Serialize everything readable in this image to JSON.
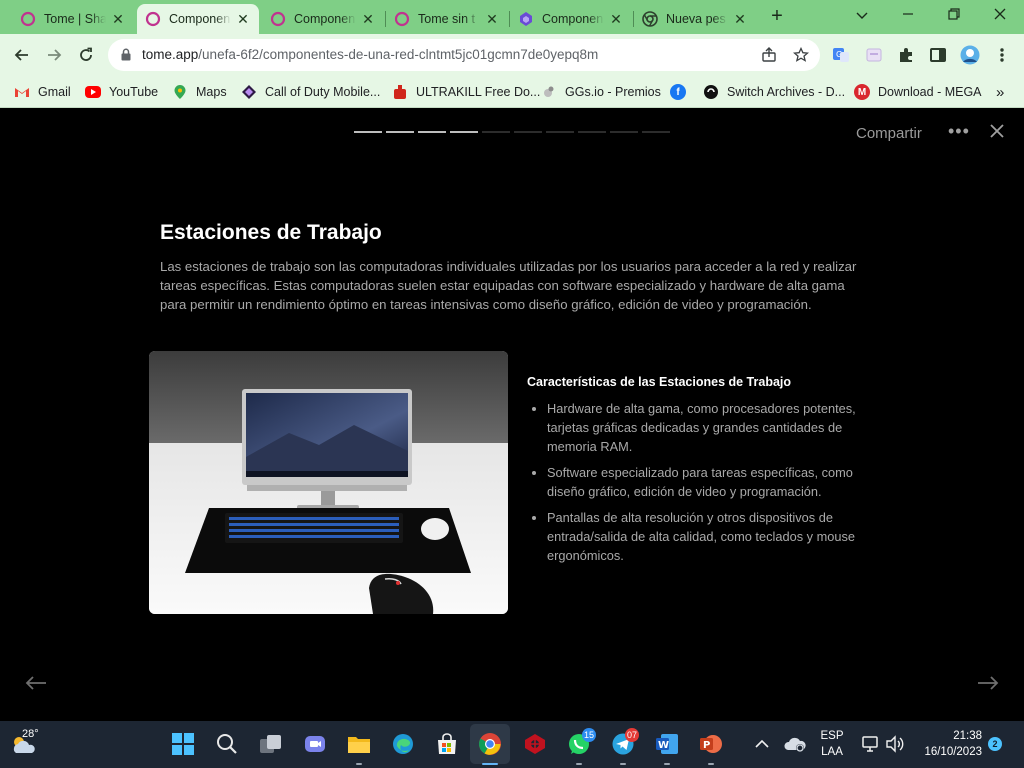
{
  "tabs": [
    {
      "title": "Tome | Sha",
      "active": false
    },
    {
      "title": "Componen",
      "active": true
    },
    {
      "title": "Componen",
      "active": false
    },
    {
      "title": "Tome sin t",
      "active": false
    },
    {
      "title": "Componen",
      "active": false
    },
    {
      "title": "Nueva pes",
      "active": false
    }
  ],
  "address": {
    "host": "tome.app",
    "path": "/unefa-6f2/componentes-de-una-red-clntmt5jc01gcmn7de0yepq8m"
  },
  "bookmarks": [
    {
      "label": "Gmail",
      "icon": "gmail-icon",
      "color": "#ea4335"
    },
    {
      "label": "YouTube",
      "icon": "youtube-icon",
      "color": "#ff0000"
    },
    {
      "label": "Maps",
      "icon": "maps-icon",
      "color": "#34a853"
    },
    {
      "label": "Call of Duty Mobile...",
      "icon": "codm-icon",
      "color": "#2d1a44"
    },
    {
      "label": "ULTRAKILL Free Do...",
      "icon": "ultrakill-icon",
      "color": "#d0261b"
    },
    {
      "label": "GGs.io - Premios",
      "icon": "ggs-icon",
      "color": "#9e9e9e"
    },
    {
      "label": "",
      "icon": "facebook-icon",
      "color": "#1877f2"
    },
    {
      "label": "Switch Archives - D...",
      "icon": "switch-archives-icon",
      "color": "#111111"
    },
    {
      "label": "Download - MEGA",
      "icon": "mega-icon",
      "color": "#d9272e"
    }
  ],
  "bookmarks_overflow": "»",
  "slide": {
    "share_label": "Compartir",
    "more_label": "•••",
    "progress_total": 10,
    "progress_current": 4,
    "heading": "Estaciones de Trabajo",
    "paragraph": "Las estaciones de trabajo son las computadoras individuales utilizadas por los usuarios para acceder a la red y realizar tareas específicas. Estas computadoras suelen estar equipadas con software especializado y hardware de alta gama para permitir un rendimiento óptimo en tareas intensivas como diseño gráfico, edición de video y programación.",
    "features_title": "Características de las Estaciones de Trabajo",
    "features": [
      "Hardware de alta gama, como procesadores potentes, tarjetas gráficas dedicadas y grandes cantidades de memoria RAM.",
      "Software especializado para tareas específicas, como diseño gráfico, edición de video y programación.",
      "Pantallas de alta resolución y otros dispositivos de entrada/salida de alta calidad, como teclados y mouse ergonómicos."
    ]
  },
  "taskbar": {
    "weather_temp": "28°",
    "whatsapp_badge": "15",
    "telegram_badge": "07",
    "lang_top": "ESP",
    "lang_bottom": "LAA",
    "time": "21:38",
    "date": "16/10/2023",
    "notifications": "2"
  },
  "colors": {
    "chrome_frame": "#7fcf86",
    "chrome_toolbar": "#e6f7e5",
    "slide_bg": "#000000",
    "taskbar_bg": "#1d2633"
  }
}
